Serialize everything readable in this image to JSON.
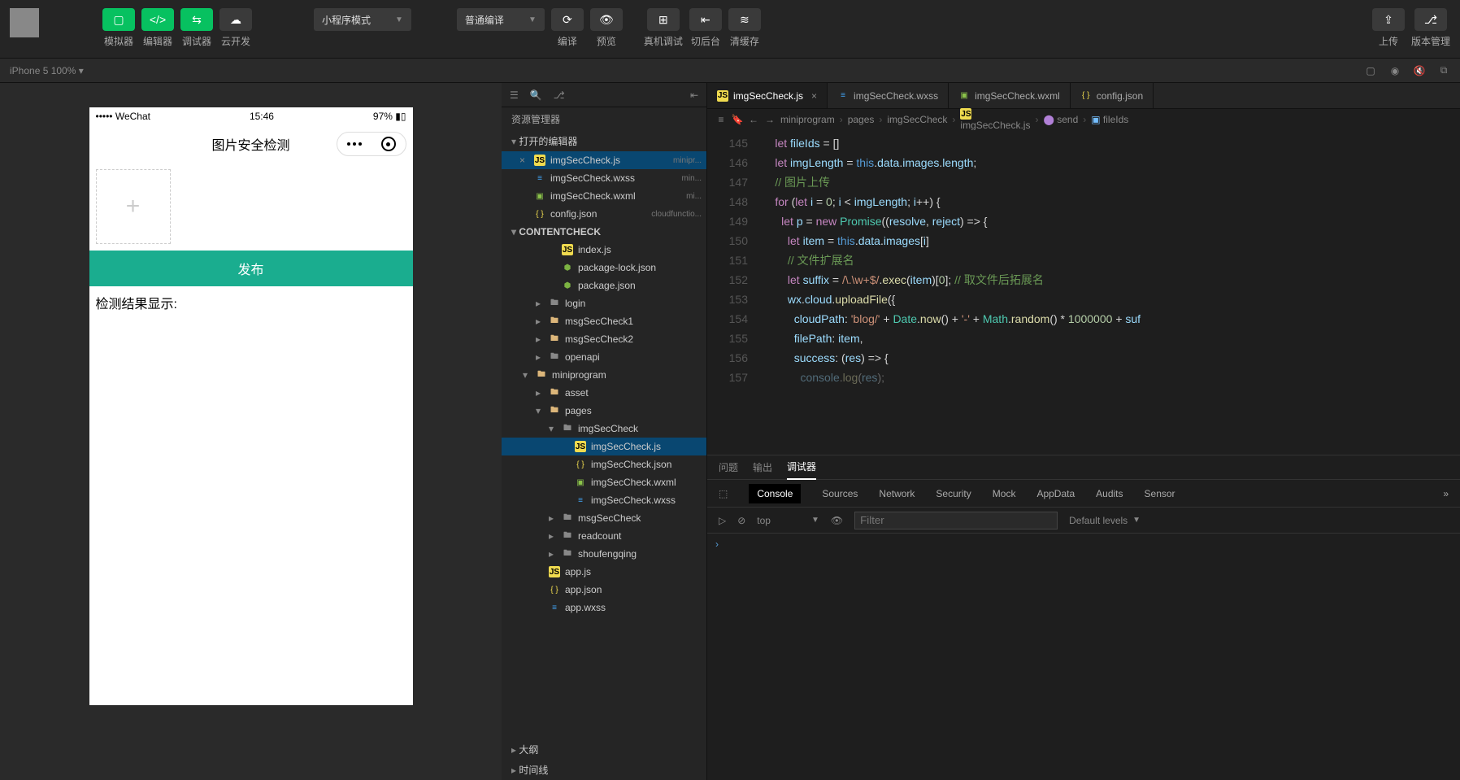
{
  "toolbar": {
    "simulator": "模拟器",
    "editor": "编辑器",
    "debugger": "调试器",
    "cloud": "云开发",
    "mode": "小程序模式",
    "compileMode": "普通编译",
    "compile": "编译",
    "preview": "预览",
    "remote": "真机调试",
    "background": "切后台",
    "clearCache": "清缓存",
    "upload": "上传",
    "version": "版本管理"
  },
  "device": {
    "name": "iPhone 5 100%",
    "arrow": "▾"
  },
  "phone": {
    "carrier": "WeChat",
    "time": "15:46",
    "battery": "97%",
    "title": "图片安全检测",
    "publish": "发布",
    "result": "检测结果显示:"
  },
  "explorer": {
    "title": "资源管理器",
    "openEditors": "打开的编辑器",
    "project": "CONTENTCHECK",
    "outline": "大纲",
    "timeline": "时间线",
    "open": [
      {
        "name": "imgSecCheck.js",
        "meta": "minipr...",
        "icon": "js",
        "active": true,
        "close": "×"
      },
      {
        "name": "imgSecCheck.wxss",
        "meta": "min...",
        "icon": "wxss"
      },
      {
        "name": "imgSecCheck.wxml",
        "meta": "mi...",
        "icon": "wxml"
      },
      {
        "name": "config.json",
        "meta": "cloudfunctio...",
        "icon": "json"
      }
    ],
    "tree": [
      {
        "d": 3,
        "a": "",
        "ic": "js",
        "n": "index.js"
      },
      {
        "d": 3,
        "a": "",
        "ic": "cloud",
        "n": "package-lock.json"
      },
      {
        "d": 3,
        "a": "",
        "ic": "cloud",
        "n": "package.json"
      },
      {
        "d": 2,
        "a": "▸",
        "ic": "folder",
        "n": "login"
      },
      {
        "d": 2,
        "a": "▸",
        "ic": "folder-o",
        "n": "msgSecCheck1"
      },
      {
        "d": 2,
        "a": "▸",
        "ic": "folder-o",
        "n": "msgSecCheck2"
      },
      {
        "d": 2,
        "a": "▸",
        "ic": "folder",
        "n": "openapi"
      },
      {
        "d": 1,
        "a": "▾",
        "ic": "folder-o",
        "n": "miniprogram"
      },
      {
        "d": 2,
        "a": "▸",
        "ic": "folder-o",
        "n": "asset"
      },
      {
        "d": 2,
        "a": "▾",
        "ic": "folder-o",
        "n": "pages"
      },
      {
        "d": 3,
        "a": "▾",
        "ic": "folder",
        "n": "imgSecCheck"
      },
      {
        "d": 4,
        "a": "",
        "ic": "js",
        "n": "imgSecCheck.js",
        "active": true
      },
      {
        "d": 4,
        "a": "",
        "ic": "json",
        "n": "imgSecCheck.json"
      },
      {
        "d": 4,
        "a": "",
        "ic": "wxml",
        "n": "imgSecCheck.wxml"
      },
      {
        "d": 4,
        "a": "",
        "ic": "wxss",
        "n": "imgSecCheck.wxss"
      },
      {
        "d": 3,
        "a": "▸",
        "ic": "folder",
        "n": "msgSecCheck"
      },
      {
        "d": 3,
        "a": "▸",
        "ic": "folder",
        "n": "readcount"
      },
      {
        "d": 3,
        "a": "▸",
        "ic": "folder",
        "n": "shoufengqing"
      },
      {
        "d": 2,
        "a": "",
        "ic": "js",
        "n": "app.js"
      },
      {
        "d": 2,
        "a": "",
        "ic": "json",
        "n": "app.json"
      },
      {
        "d": 2,
        "a": "",
        "ic": "wxss",
        "n": "app.wxss"
      }
    ]
  },
  "editor": {
    "tabs": [
      {
        "name": "imgSecCheck.js",
        "icon": "js",
        "active": true,
        "x": "×"
      },
      {
        "name": "imgSecCheck.wxss",
        "icon": "wxss"
      },
      {
        "name": "imgSecCheck.wxml",
        "icon": "wxml"
      },
      {
        "name": "config.json",
        "icon": "json"
      }
    ],
    "breadcrumb": [
      "miniprogram",
      "pages",
      "imgSecCheck",
      "imgSecCheck.js",
      "send",
      "fileIds"
    ],
    "startLine": 145,
    "lineCount": 13
  },
  "panel": {
    "tabs": [
      "问题",
      "输出",
      "调试器"
    ],
    "devtabs": [
      "Console",
      "Sources",
      "Network",
      "Security",
      "Mock",
      "AppData",
      "Audits",
      "Sensor"
    ],
    "context": "top",
    "filter": "Filter",
    "levels": "Default levels",
    "prompt": "›"
  }
}
